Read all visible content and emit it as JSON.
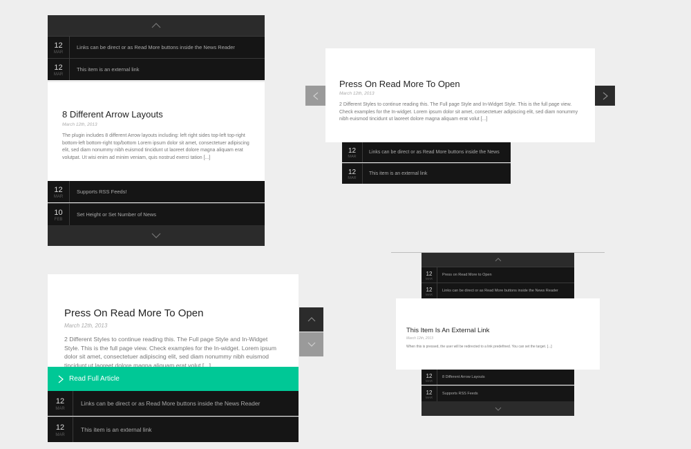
{
  "w1": {
    "rows_top": [
      {
        "day": "12",
        "month": "MAR",
        "text": "Links can be direct or as Read More buttons inside the News Reader"
      },
      {
        "day": "12",
        "month": "MAR",
        "text": "This item is an external link"
      }
    ],
    "card": {
      "title": "8 Different Arrow Layouts",
      "date": "March 12th, 2013",
      "body": "The plugin includes 8 different Arrow layouts including: left right sides top-left top-right bottom-left bottom-right top/bottom Lorem ipsum dolor sit amet, consectetuer adipiscing elit, sed diam nonummy nibh euismod tincidunt ut laoreet dolore magna aliquam erat volutpat. Ut wisi enim ad minim veniam, quis nostrud exerci tation [...]"
    },
    "rows_bottom": [
      {
        "day": "12",
        "month": "MAR",
        "text": "Supports RSS Feeds!"
      },
      {
        "day": "10",
        "month": "FEB",
        "text": "Set Height or Set Number of News"
      }
    ]
  },
  "w2": {
    "card": {
      "title": "Press On Read More To Open",
      "date": "March 12th, 2013",
      "body": "2 Different Styles to continue reading this. The Full page Style and In-Widget Style. This is the full page view. Check examples for the In-widget. Lorem ipsum dolor sit amet, consectetuer adipiscing elit, sed diam nonummy nibh euismod tincidunt ut laoreet dolore magna aliquam erat volut [...]"
    },
    "rows": [
      {
        "day": "12",
        "month": "MAR",
        "text": "Links can be direct or as Read More buttons inside the News"
      },
      {
        "day": "12",
        "month": "MAR",
        "text": "This item is an external link"
      }
    ]
  },
  "w3": {
    "card": {
      "title": "Press On Read More To Open",
      "date": "March 12th, 2013",
      "body": "2 Different Styles to continue reading this. The Full page Style and In-Widget Style. This is the full page view. Check examples for the In-widget. Lorem ipsum dolor sit amet, consectetuer adipiscing elit, sed diam nonummy nibh euismod tincidunt ut laoreet dolore magna aliquam erat volut [...]"
    },
    "read_full_label": "Read Full Article",
    "rows": [
      {
        "day": "12",
        "month": "MAR",
        "text": "Links can be direct or as Read More buttons inside the News Reader"
      },
      {
        "day": "12",
        "month": "MAR",
        "text": "This item is an external link"
      }
    ],
    "accent_color": "#00c896"
  },
  "w4": {
    "rows_top": [
      {
        "day": "12",
        "month": "MAR",
        "text": "Press on Read More to Open"
      },
      {
        "day": "12",
        "month": "MAR",
        "text": "Links can be direct or as Read More buttons inside the News Reader"
      }
    ],
    "card": {
      "title": "This Item Is An External Link",
      "date": "March 12th, 2013",
      "body": "When this is pressed, the user will be redirected to a link predefined. You can set the target. [...]"
    },
    "rows_bottom": [
      {
        "day": "12",
        "month": "MAR",
        "text": "8 Different Arrow Layouts"
      },
      {
        "day": "12",
        "month": "MAR",
        "text": "Supports RSS Feeds"
      }
    ]
  }
}
